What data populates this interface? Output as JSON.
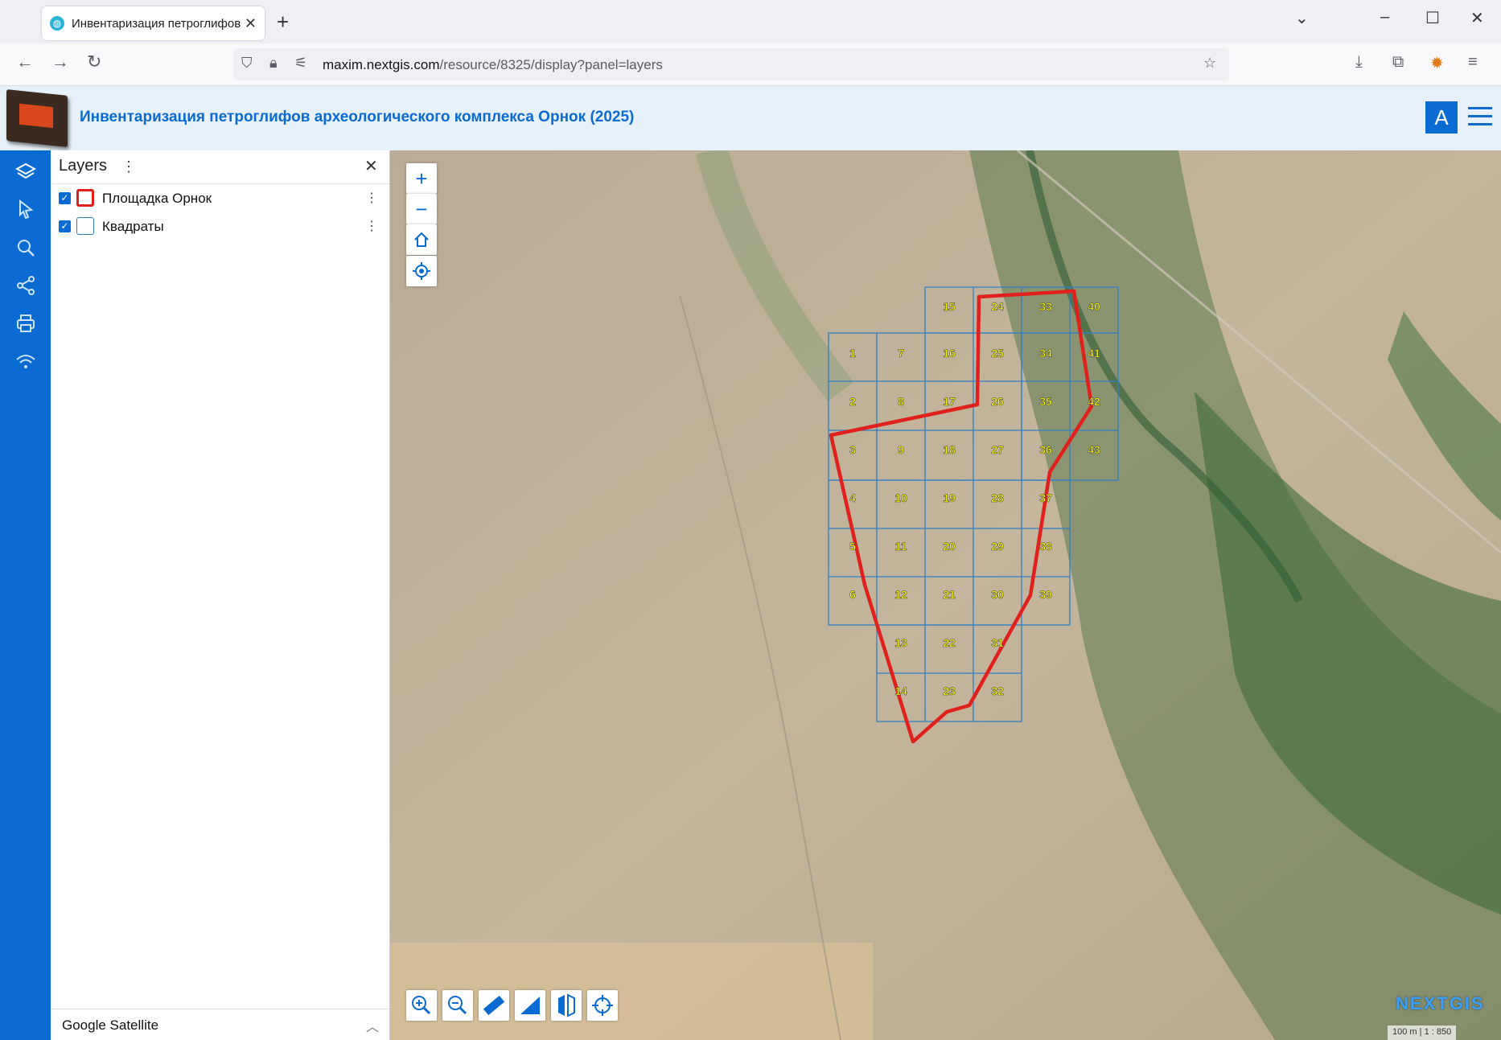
{
  "browser": {
    "tab_title": "Инвентаризация петроглифов",
    "new_tab_symbol": "+",
    "url_host": "maxim.nextgis.com",
    "url_path": "/resource/8325/display?panel=layers"
  },
  "app": {
    "title": "Инвентаризация петроглифов археологического комплекса Орнок (2025)",
    "user_initial": "A"
  },
  "panel": {
    "title": "Layers",
    "layers": [
      {
        "name": "Площадка Орнок",
        "checked": true,
        "symbol": "red-outline"
      },
      {
        "name": "Квадраты",
        "checked": true,
        "symbol": "blue-outline"
      }
    ],
    "basemap": "Google Satellite"
  },
  "map": {
    "brand_left": "N",
    "brand_mid": "EXT",
    "brand_right": "GIS",
    "scale_text": "100 m",
    "scale_ratio": "1 : 850",
    "grid_labels": [
      "1",
      "2",
      "3",
      "4",
      "5",
      "6",
      "7",
      "8",
      "9",
      "10",
      "11",
      "12",
      "13",
      "14",
      "15",
      "16",
      "17",
      "18",
      "19",
      "20",
      "21",
      "22",
      "23",
      "24",
      "25",
      "26",
      "27",
      "28",
      "29",
      "30",
      "31",
      "32",
      "33",
      "34",
      "35",
      "36",
      "37",
      "38",
      "39",
      "40",
      "41",
      "42",
      "43"
    ]
  },
  "colors": {
    "primary": "#0a6bd2",
    "polygon": "#e0201c",
    "grid": "#2f7fc4",
    "label": "#ffff00"
  }
}
